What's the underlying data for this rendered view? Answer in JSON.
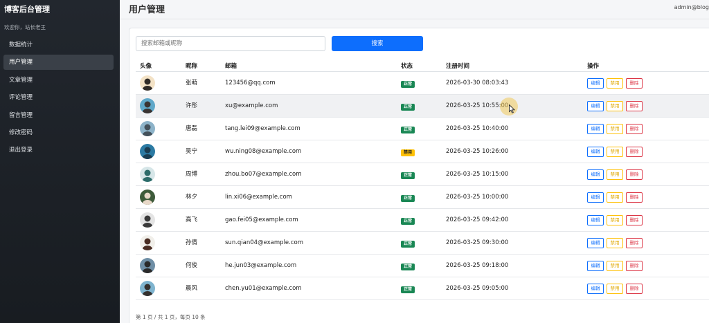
{
  "sidebar": {
    "brand": "博客后台管理",
    "welcome": "欢迎你，站长老王",
    "items": [
      {
        "label": "数据统计",
        "active": false
      },
      {
        "label": "用户管理",
        "active": true
      },
      {
        "label": "文章管理",
        "active": false
      },
      {
        "label": "评论管理",
        "active": false
      },
      {
        "label": "留言管理",
        "active": false
      },
      {
        "label": "修改密码",
        "active": false
      },
      {
        "label": "退出登录",
        "active": false
      }
    ]
  },
  "header": {
    "title": "用户管理",
    "user": "admin@blog"
  },
  "search": {
    "placeholder": "搜索邮箱或昵称",
    "value": "",
    "button_label": "搜索"
  },
  "table": {
    "columns": [
      "头像",
      "昵称",
      "邮箱",
      "状态",
      "注册时间",
      "操作"
    ],
    "rows": [
      {
        "nickname": "张萌",
        "email": "123456@qq.com",
        "status": "正常",
        "status_type": "ok",
        "registered": "2026-03-30 08:03:43",
        "avatar_colors": [
          "#f3e2c6",
          "#2f2a26"
        ]
      },
      {
        "nickname": "许彤",
        "email": "xu@example.com",
        "status": "正常",
        "status_type": "ok",
        "registered": "2026-03-25 10:55:00",
        "avatar_colors": [
          "#5fa8c9",
          "#3a3432"
        ]
      },
      {
        "nickname": "唐磊",
        "email": "tang.lei09@example.com",
        "status": "正常",
        "status_type": "ok",
        "registered": "2026-03-25 10:40:00",
        "avatar_colors": [
          "#8db3c9",
          "#43505a"
        ]
      },
      {
        "nickname": "吴宁",
        "email": "wu.ning08@example.com",
        "status": "禁用",
        "status_type": "off",
        "registered": "2026-03-25 10:26:00",
        "avatar_colors": [
          "#2b7aa3",
          "#1a3d52"
        ]
      },
      {
        "nickname": "周博",
        "email": "zhou.bo07@example.com",
        "status": "正常",
        "status_type": "ok",
        "registered": "2026-03-25 10:15:00",
        "avatar_colors": [
          "#d6e6e8",
          "#2c6c6a"
        ]
      },
      {
        "nickname": "林夕",
        "email": "lin.xi06@example.com",
        "status": "正常",
        "status_type": "ok",
        "registered": "2026-03-25 10:00:00",
        "avatar_colors": [
          "#3e5b3a",
          "#e8d8c8"
        ]
      },
      {
        "nickname": "高飞",
        "email": "gao.fei05@example.com",
        "status": "正常",
        "status_type": "ok",
        "registered": "2026-03-25 09:42:00",
        "avatar_colors": [
          "#e4e4e4",
          "#3a3a3a"
        ]
      },
      {
        "nickname": "孙倩",
        "email": "sun.qian04@example.com",
        "status": "正常",
        "status_type": "ok",
        "registered": "2026-03-25 09:30:00",
        "avatar_colors": [
          "#f1efea",
          "#4a2c22"
        ]
      },
      {
        "nickname": "何俊",
        "email": "he.jun03@example.com",
        "status": "正常",
        "status_type": "ok",
        "registered": "2026-03-25 09:18:00",
        "avatar_colors": [
          "#6f8fa6",
          "#2a2a2a"
        ]
      },
      {
        "nickname": "晨风",
        "email": "chen.yu01@example.com",
        "status": "正常",
        "status_type": "ok",
        "registered": "2026-03-25 09:05:00",
        "avatar_colors": [
          "#7fb4cf",
          "#34302e"
        ]
      }
    ],
    "actions": {
      "edit": "编辑",
      "disable": "禁用",
      "delete": "删除"
    }
  },
  "pagination": {
    "text": "第 1 页 / 共 1 页，每页 10 条"
  },
  "colors": {
    "primary": "#0d6efd",
    "success": "#198754",
    "warning": "#ffc107",
    "danger": "#dc3545",
    "sidebar_bg": "#1d2127"
  },
  "icons": {
    "cursor": "mouse-pointer-icon"
  }
}
